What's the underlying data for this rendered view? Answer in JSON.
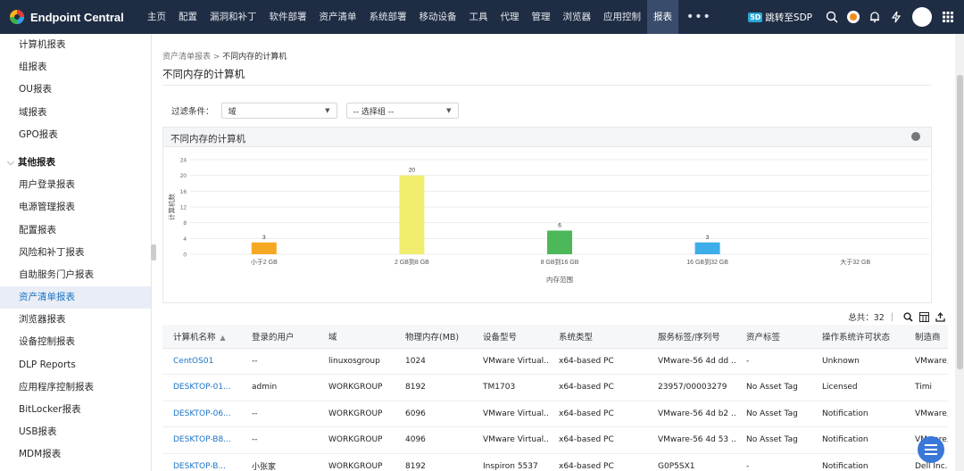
{
  "app": {
    "name": "Endpoint Central"
  },
  "nav": [
    "主页",
    "配置",
    "漏洞和补丁",
    "软件部署",
    "资产清单",
    "系统部署",
    "移动设备",
    "工具",
    "代理",
    "管理",
    "浏览器",
    "应用控制",
    "报表"
  ],
  "nav_more": "•••",
  "topbar": {
    "sdp_badge": "5D",
    "sdp_label": "跳转至SDP"
  },
  "sidebar": {
    "items_top": [
      "计算机报表",
      "组报表",
      "OU报表",
      "域报表",
      "GPO报表"
    ],
    "section": "其他报表",
    "items": [
      "用户登录报表",
      "电源管理报表",
      "配置报表",
      "风险和补丁报表",
      "自助服务门户报表",
      "资产清单报表",
      "浏览器报表",
      "设备控制报表",
      "DLP Reports",
      "应用程序控制报表",
      "BitLocker报表",
      "USB报表",
      "MDM报表"
    ]
  },
  "breadcrumb": {
    "parent": "资产清单报表",
    "sep": " > ",
    "current": "不同内存的计算机"
  },
  "page_title": "不同内存的计算机",
  "filter": {
    "label": "过滤条件：",
    "domain_value": "域",
    "group_value": "-- 选择组 --"
  },
  "chart_card": {
    "title": "不同内存的计算机"
  },
  "chart_data": {
    "type": "bar",
    "categories": [
      "小于2 GB",
      "2 GB到8 GB",
      "8 GB到16 GB",
      "16 GB到32 GB",
      "大于32 GB"
    ],
    "values": [
      3,
      20,
      6,
      3,
      0
    ],
    "colors": [
      "#f7a823",
      "#f2ed6f",
      "#4cb85a",
      "#3daee9",
      "#cccccc"
    ],
    "xlabel": "内存范围",
    "ylabel": "计算机数",
    "ylim": [
      0,
      24
    ],
    "yticks": [
      0,
      4,
      8,
      12,
      16,
      20,
      24
    ]
  },
  "table": {
    "total_label": "总共：32",
    "columns": [
      "计算机名称",
      "登录的用户",
      "域",
      "物理内存(MB)",
      "设备型号",
      "系统类型",
      "服务标签/序列号",
      "资产标签",
      "操作系统许可状态",
      "制造商"
    ],
    "sort_indicator": "▲",
    "rows": [
      [
        "CentOS01",
        "--",
        "linuxosgroup",
        "1024",
        "VMware Virtual...",
        "x64-based PC",
        "VMware-56 4d dd ...",
        "-",
        "Unknown",
        "VMware, Inc"
      ],
      [
        "DESKTOP-01...",
        "admin",
        "WORKGROUP",
        "8192",
        "TM1703",
        "x64-based PC",
        "23957/00003279",
        "No Asset Tag",
        "Licensed",
        "Timi"
      ],
      [
        "DESKTOP-06...",
        "--",
        "WORKGROUP",
        "6096",
        "VMware Virtual...",
        "x64-based PC",
        "VMware-56 4d b2 ...",
        "No Asset Tag",
        "Notification",
        "VMware, Inc"
      ],
      [
        "DESKTOP-B8...",
        "--",
        "WORKGROUP",
        "4096",
        "VMware Virtual...",
        "x64-based PC",
        "VMware-56 4d 53 ...",
        "No Asset Tag",
        "Notification",
        "VMware, Inc"
      ],
      [
        "DESKTOP-B...",
        "小张家",
        "WORKGROUP",
        "8192",
        "Inspiron 5537",
        "x64-based PC",
        "G0P5SX1",
        "-",
        "Notification",
        "Dell Inc."
      ]
    ]
  },
  "colors": {
    "topbar": "#1f2d44",
    "accent": "#1b73c6"
  }
}
